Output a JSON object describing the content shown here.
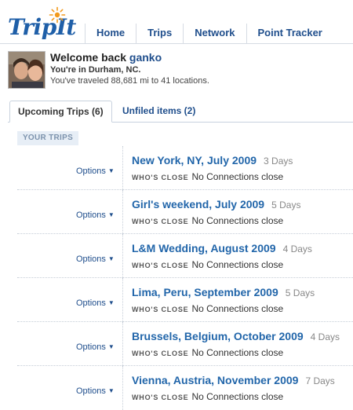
{
  "brand": {
    "logo_text": "TripIt"
  },
  "nav": {
    "items": [
      {
        "label": "Home"
      },
      {
        "label": "Trips"
      },
      {
        "label": "Network"
      },
      {
        "label": "Point Tracker"
      }
    ]
  },
  "welcome": {
    "greeting": "Welcome back",
    "username": "ganko",
    "location": "You're in Durham, NC.",
    "stats": "You've traveled 88,681 mi to 41 locations."
  },
  "tabs": [
    {
      "label": "Upcoming Trips (6)",
      "active": true
    },
    {
      "label": "Unfiled items (2)",
      "active": false
    }
  ],
  "section_label": "YOUR TRIPS",
  "trips": [
    {
      "title": "New York, NY, July 2009",
      "days": "3 Days",
      "options": "Options",
      "close_label": "WHO'S CLOSE",
      "close_value": "No Connections close"
    },
    {
      "title": "Girl's weekend, July 2009",
      "days": "5 Days",
      "options": "Options",
      "close_label": "WHO'S CLOSE",
      "close_value": "No Connections close"
    },
    {
      "title": "L&M Wedding, August 2009",
      "days": "4 Days",
      "options": "Options",
      "close_label": "WHO'S CLOSE",
      "close_value": "No Connections close"
    },
    {
      "title": "Lima, Peru, September 2009",
      "days": "5 Days",
      "options": "Options",
      "close_label": "WHO'S CLOSE",
      "close_value": "No Connections close"
    },
    {
      "title": "Brussels, Belgium, October 2009",
      "days": "4 Days",
      "options": "Options",
      "close_label": "WHO'S CLOSE",
      "close_value": "No Connections close"
    },
    {
      "title": "Vienna, Austria, November 2009",
      "days": "7 Days",
      "options": "Options",
      "close_label": "WHO'S CLOSE",
      "close_value": "No Connections close"
    }
  ],
  "colors": {
    "link_blue": "#1f4e8c",
    "trip_title_blue": "#2266aa",
    "label_bg": "#e7eef6",
    "logo_sun_orange": "#f29a1d"
  }
}
